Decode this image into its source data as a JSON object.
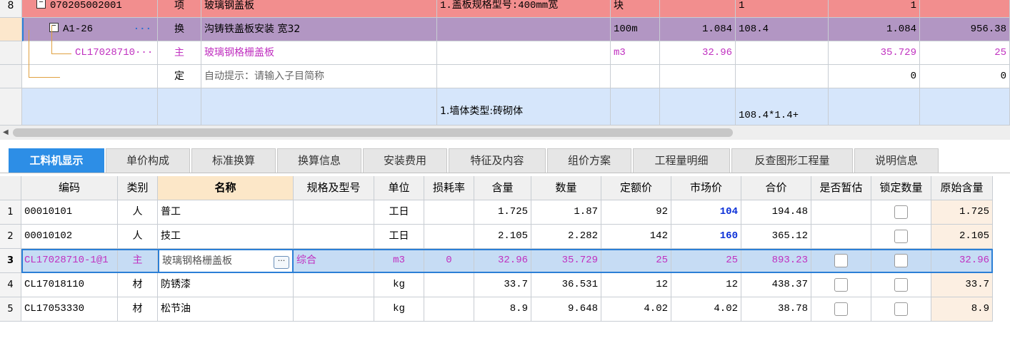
{
  "top_grid": {
    "rows": [
      {
        "idx": "8",
        "code": "070205002001",
        "type": "项",
        "name": "玻璃钢盖板",
        "feature": "1.盖板规格型号:400mm宽",
        "unit": "块",
        "qty_expr": "",
        "qty": "1",
        "dup": "1",
        "last": ""
      },
      {
        "idx": "",
        "code": "A1-26",
        "more": "···",
        "type": "换",
        "name": "沟铸铁盖板安装 宽32",
        "feature": "",
        "unit": "100m",
        "qty_expr": "1.084",
        "qty": "108.4",
        "dup": "1.084",
        "last": "956.38"
      },
      {
        "idx": "",
        "code": "CL17028710···",
        "type": "主",
        "name": "玻璃钢格栅盖板",
        "feature": "",
        "unit": "m3",
        "qty_expr": "32.96",
        "qty": "",
        "dup": "35.729",
        "last": "25"
      },
      {
        "idx": "",
        "code": "",
        "type": "定",
        "name": "自动提示：请输入子目简称",
        "feature": "",
        "unit": "",
        "qty_expr": "",
        "qty": "",
        "dup": "0",
        "last": "0"
      },
      {
        "idx": "",
        "code": "",
        "type": "",
        "name": "",
        "feature": "1.墙体类型:砖砌体",
        "unit": "",
        "qty_expr": "",
        "qty": "108.4*1.4+",
        "dup": "",
        "last": ""
      }
    ]
  },
  "tabs": [
    "工料机显示",
    "单价构成",
    "标准换算",
    "换算信息",
    "安装费用",
    "特征及内容",
    "组价方案",
    "工程量明细",
    "反查图形工程量",
    "说明信息"
  ],
  "active_tab": 0,
  "grid": {
    "headers": [
      "",
      "编码",
      "类别",
      "名称",
      "规格及型号",
      "单位",
      "损耗率",
      "含量",
      "数量",
      "定额价",
      "市场价",
      "合价",
      "是否暂估",
      "锁定数量",
      "原始含量"
    ],
    "rows": [
      {
        "idx": "1",
        "code": "00010101",
        "cat": "人",
        "name": "普工",
        "spec": "",
        "unit": "工日",
        "loss": "",
        "content": "1.725",
        "qty": "1.87",
        "quota": "92",
        "market": "104",
        "total": "194.48",
        "est": false,
        "lock": true,
        "orig": "1.725"
      },
      {
        "idx": "2",
        "code": "00010102",
        "cat": "人",
        "name": "技工",
        "spec": "",
        "unit": "工日",
        "loss": "",
        "content": "2.105",
        "qty": "2.282",
        "quota": "142",
        "market": "160",
        "total": "365.12",
        "est": false,
        "lock": true,
        "orig": "2.105"
      },
      {
        "idx": "3",
        "code": "CL17028710-1@1",
        "cat": "主",
        "name": "玻璃钢格栅盖板",
        "spec": "综合",
        "unit": "m3",
        "loss": "0",
        "content": "32.96",
        "qty": "35.729",
        "quota": "25",
        "market": "25",
        "total": "893.23",
        "est": true,
        "lock": true,
        "orig": "32.96"
      },
      {
        "idx": "4",
        "code": "CL17018110",
        "cat": "材",
        "name": "防锈漆",
        "spec": "",
        "unit": "kg",
        "loss": "",
        "content": "33.7",
        "qty": "36.531",
        "quota": "12",
        "market": "12",
        "total": "438.37",
        "est": true,
        "lock": true,
        "orig": "33.7"
      },
      {
        "idx": "5",
        "code": "CL17053330",
        "cat": "材",
        "name": "松节油",
        "spec": "",
        "unit": "kg",
        "loss": "",
        "content": "8.9",
        "qty": "9.648",
        "quota": "4.02",
        "market": "4.02",
        "total": "38.78",
        "est": true,
        "lock": true,
        "orig": "8.9"
      }
    ],
    "ellipsis": "···"
  },
  "colors": {
    "red_row": "#f28e8e",
    "purple_row": "#b296c3",
    "blue_row": "#d6e6fb",
    "active_tab": "#2d8ee6",
    "selected_row": "#c6dcf4",
    "market_price_blue": "#0a2fd8"
  }
}
